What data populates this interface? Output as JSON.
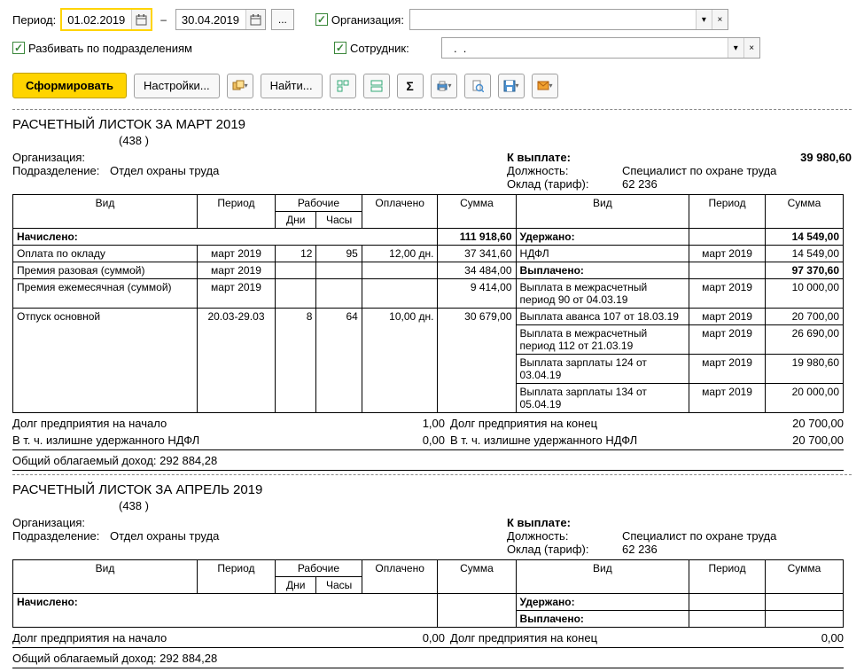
{
  "toolbar": {
    "period_label": "Период:",
    "date_from": "01.02.2019",
    "date_to": "30.04.2019",
    "ellipsis": "...",
    "org_label": "Организация:",
    "breakdown_label": "Разбивать по подразделениям",
    "emp_label": "Сотрудник:",
    "emp_value": "  .  ."
  },
  "actions": {
    "generate": "Сформировать",
    "settings": "Настройки...",
    "find": "Найти..."
  },
  "slip1": {
    "title": "РАСЧЕТНЫЙ ЛИСТОК ЗА МАРТ 2019",
    "emp_num": "(438       )",
    "org_label": "Организация:",
    "dept_label": "Подразделение:",
    "dept_value": "Отдел охраны труда",
    "pay_label": "К выплате:",
    "pay_value": "39 980,60",
    "pos_label": "Должность:",
    "pos_value": "Специалист по охране труда",
    "rate_label": "Оклад (тариф):",
    "rate_value": "62 236",
    "hdr": {
      "vid": "Вид",
      "period": "Период",
      "work": "Рабочие",
      "days": "Дни",
      "hours": "Часы",
      "paid": "Оплачено",
      "sum": "Сумма"
    },
    "accrued_label": "Начислено:",
    "accrued_total": "111 918,60",
    "withheld_label": "Удержано:",
    "withheld_total": "14 549,00",
    "paid_label": "Выплачено:",
    "paid_total": "97 370,60",
    "r1": {
      "vid": "Оплата по окладу",
      "per": "март 2019",
      "d": "12",
      "h": "95",
      "paid": "12,00 дн.",
      "sum": "37 341,60"
    },
    "r2": {
      "vid": "Премия разовая (суммой)",
      "per": "март 2019",
      "sum": "34 484,00"
    },
    "r3": {
      "vid": "Премия ежемесячная (суммой)",
      "per": "март 2019",
      "sum": "9 414,00"
    },
    "r4": {
      "vid": "Отпуск основной",
      "per": "20.03-29.03",
      "d": "8",
      "h": "64",
      "paid": "10,00 дн.",
      "sum": "30 679,00"
    },
    "ndfl": {
      "vid": "НДФЛ",
      "per": "март 2019",
      "sum": "14 549,00"
    },
    "p1": {
      "vid": "Выплата в межрасчетный период 90 от 04.03.19",
      "per": "март 2019",
      "sum": "10 000,00"
    },
    "p2": {
      "vid": "Выплата аванса 107 от 18.03.19",
      "per": "март 2019",
      "sum": "20 700,00"
    },
    "p3": {
      "vid": "Выплата в межрасчетный период 112 от 21.03.19",
      "per": "март 2019",
      "sum": "26 690,00"
    },
    "p4": {
      "vid": "Выплата зарплаты 124 от 03.04.19",
      "per": "март 2019",
      "sum": "19 980,60"
    },
    "p5": {
      "vid": "Выплата зарплаты 134 от 05.04.19",
      "per": "март 2019",
      "sum": "20 000,00"
    },
    "debt_start_label": "Долг предприятия на начало",
    "debt_start_val": "1,00",
    "debt_end_label": "Долг предприятия на конец",
    "debt_end_val": "20 700,00",
    "ndfl_over_label": "  В т. ч. излишне удержанного НДФЛ",
    "ndfl_over_start": "0,00",
    "ndfl_over_end": "20 700,00",
    "taxable_label": "Общий облагаемый доход:",
    "taxable_val": "292 884,28"
  },
  "slip2": {
    "title": "РАСЧЕТНЫЙ ЛИСТОК ЗА АПРЕЛЬ 2019",
    "emp_num": "(438       )",
    "org_label": "Организация:",
    "dept_label": "Подразделение:",
    "dept_value": "Отдел охраны труда",
    "pay_label": "К выплате:",
    "pos_label": "Должность:",
    "pos_value": "Специалист по охране труда",
    "rate_label": "Оклад (тариф):",
    "rate_value": "62 236",
    "accrued_label": "Начислено:",
    "withheld_label": "Удержано:",
    "paid_label": "Выплачено:",
    "debt_start_label": "Долг предприятия на начало",
    "debt_start_val": "0,00",
    "debt_end_label": "Долг предприятия на конец",
    "debt_end_val": "0,00",
    "taxable_label": "Общий облагаемый доход:",
    "taxable_val": "292 884,28"
  }
}
